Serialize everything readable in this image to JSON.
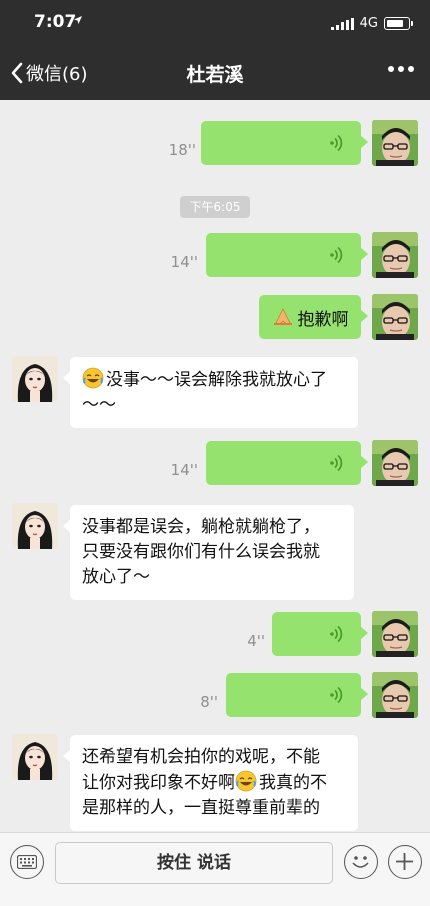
{
  "status": {
    "time": "7:07",
    "network": "4G",
    "battery_level": 0.82
  },
  "nav": {
    "back_label": "微信(6)",
    "title": "杜若溪"
  },
  "time_separator": "下午6:05",
  "messages": [
    {
      "from": "me",
      "type": "voice",
      "duration": "18''"
    },
    {
      "from": "me",
      "type": "voice",
      "duration": "14''"
    },
    {
      "from": "me",
      "type": "text",
      "icon": "bow-hands-emoji",
      "text": "抱歉啊"
    },
    {
      "from": "them",
      "type": "text",
      "icon": "laughing-tears-emoji",
      "lines": [
        "没事～～误会解除我就放心了",
        "～～"
      ]
    },
    {
      "from": "me",
      "type": "voice",
      "duration": "14''"
    },
    {
      "from": "them",
      "type": "text",
      "lines": [
        "没事都是误会，躺枪就躺枪了，",
        "只要没有跟你们有什么误会我就",
        "放心了～"
      ]
    },
    {
      "from": "me",
      "type": "voice",
      "duration": "4''"
    },
    {
      "from": "me",
      "type": "voice",
      "duration": "8''"
    },
    {
      "from": "them",
      "type": "text",
      "lines": [
        "还希望有机会拍你的戏呢，不能",
        "让你对我印象不好啊",
        "我真的不",
        "是那样的人，一直挺尊重前辈的"
      ]
    }
  ],
  "input": {
    "hold_to_talk": "按住 说话"
  },
  "colors": {
    "topbar": "#2e2e2e",
    "me_bubble": "#95e36e",
    "them_bubble": "#ffffff",
    "background": "#ededed"
  }
}
